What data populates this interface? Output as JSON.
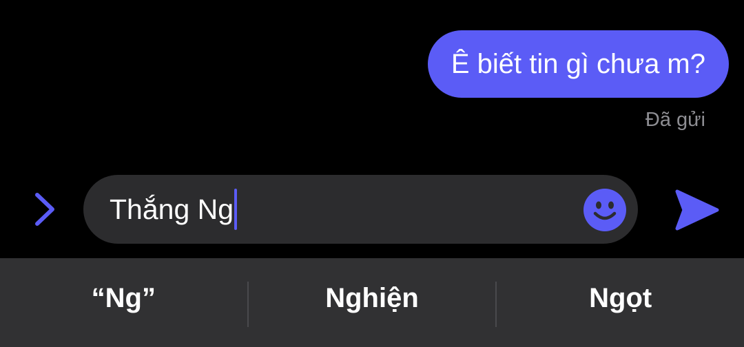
{
  "thread": {
    "messages": [
      {
        "text": "Ê biết tin gì chưa m?",
        "sender": "me",
        "status": "Đã gửi"
      }
    ]
  },
  "composer": {
    "expand_icon": "chevron-right-icon",
    "input_value": "Thắng Ng",
    "emoji_icon": "smiley-face-icon",
    "send_icon": "paper-plane-icon"
  },
  "suggestions": [
    {
      "label": "“Ng”"
    },
    {
      "label": "Nghiện"
    },
    {
      "label": "Ngọt"
    }
  ],
  "colors": {
    "accent": "#5b5cf6",
    "background": "#000000",
    "input_background": "#2c2c2e",
    "suggestion_bar": "#313133",
    "status_text": "#8e8e93"
  }
}
